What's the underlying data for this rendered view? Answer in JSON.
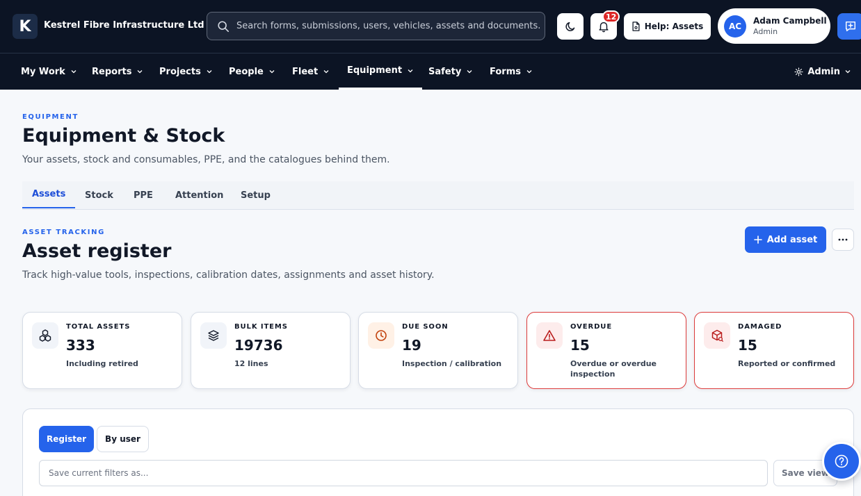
{
  "app": {
    "logo_letter": "K",
    "company_name": "Kestrel Fibre Infrastructure Ltd"
  },
  "search": {
    "placeholder": "Search forms, submissions, users, vehicles, assets and documents."
  },
  "header": {
    "notification_count": "12",
    "help_label": "Help: Assets",
    "user": {
      "initials": "AC",
      "name": "Adam Campbell",
      "role": "Admin"
    }
  },
  "nav": {
    "items": [
      {
        "label": "My Work"
      },
      {
        "label": "Reports"
      },
      {
        "label": "Projects"
      },
      {
        "label": "People"
      },
      {
        "label": "Fleet"
      },
      {
        "label": "Equipment",
        "active": true
      },
      {
        "label": "Safety"
      },
      {
        "label": "Forms"
      }
    ],
    "admin_label": "Admin"
  },
  "page": {
    "eyebrow": "EQUIPMENT",
    "title": "Equipment & Stock",
    "subtitle": "Your assets, stock and consumables, PPE, and the catalogues behind them."
  },
  "tabs": [
    {
      "label": "Assets",
      "active": true
    },
    {
      "label": "Stock"
    },
    {
      "label": "PPE"
    },
    {
      "label": "Attention"
    },
    {
      "label": "Setup"
    }
  ],
  "section": {
    "eyebrow": "ASSET TRACKING",
    "title": "Asset register",
    "subtitle": "Track high-value tools, inspections, calibration dates, assignments and asset history.",
    "add_label": "Add asset"
  },
  "stats": [
    {
      "label": "TOTAL ASSETS",
      "value": "333",
      "note": "Including retired",
      "icon": "assets-icon",
      "tone": "neutral"
    },
    {
      "label": "BULK ITEMS",
      "value": "19736",
      "note": "12 lines",
      "icon": "layers-icon",
      "tone": "neutral"
    },
    {
      "label": "DUE SOON",
      "value": "19",
      "note": "Inspection / calibration",
      "icon": "clock-icon",
      "tone": "warning"
    },
    {
      "label": "OVERDUE",
      "value": "15",
      "note": "Overdue or overdue inspection",
      "icon": "warning-icon",
      "tone": "danger"
    },
    {
      "label": "DAMAGED",
      "value": "15",
      "note": "Reported or confirmed",
      "icon": "damaged-box-icon",
      "tone": "danger"
    }
  ],
  "register": {
    "views": [
      "Register",
      "By user"
    ],
    "filter_placeholder": "Save current filters as...",
    "save_view_label": "Save view"
  },
  "colors": {
    "topbar_bg": "#0c1424",
    "accent": "#2563eb",
    "danger": "#dc3a3a",
    "warning_bg": "#fff1e6"
  }
}
